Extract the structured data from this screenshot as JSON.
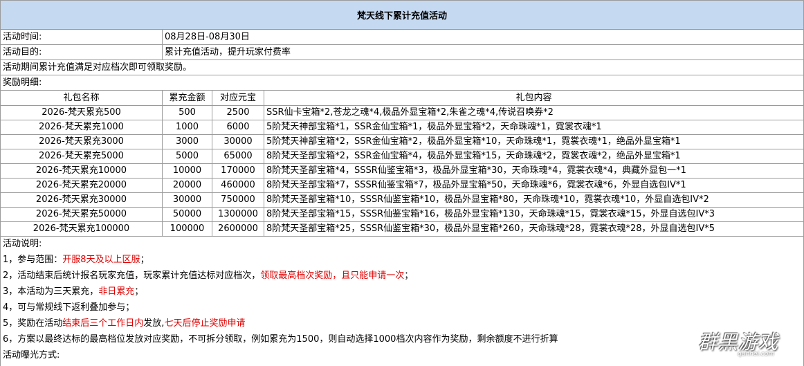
{
  "title": "梵天线下累计充值活动",
  "info": [
    {
      "label": "活动时间:",
      "value": "08月28日-08月30日"
    },
    {
      "label": "活动目的:",
      "value": "累计充值活动，提升玩家付费率"
    }
  ],
  "intro": "活动期间累计充值满足对应档次即可领取奖励。",
  "reward_label": "奖励明细:",
  "table": {
    "headers": [
      "礼包名称",
      "累充金额",
      "对应元宝",
      "礼包内容"
    ],
    "rows": [
      [
        "2026-梵天累充500",
        "500",
        "2500",
        "SSR仙卡宝箱*2,苍龙之魂*4,极品外显宝箱*2,朱雀之魂*4,传说召唤券*2"
      ],
      [
        "2026-梵天累充1000",
        "1000",
        "6000",
        "5阶梵天神部宝箱*1，SSR金仙宝箱*1，极品外显宝箱*2，天命珠魂*1，霓裳衣魂*1"
      ],
      [
        "2026-梵天累充3000",
        "3000",
        "30000",
        "5阶梵天神部宝箱*2，SSR金仙宝箱*2，极品外显宝箱*10，天命珠魂*1，霓裳衣魂*1，绝品外显宝箱*1"
      ],
      [
        "2026-梵天累充5000",
        "5000",
        "65000",
        "8阶梵天圣部宝箱*2，SSR金仙宝箱*4，极品外显宝箱*15，天命珠魂*2，霓裳衣魂*2，绝品外显宝箱*1"
      ],
      [
        "2026-梵天累充10000",
        "10000",
        "170000",
        "8阶梵天圣部宝箱*4，SSSR仙鉴宝箱*3，极品外显宝箱*30，天命珠魂*4，霓裳衣魂*4，典藏外显包一*1"
      ],
      [
        "2026-梵天累充20000",
        "20000",
        "460000",
        "8阶梵天圣部宝箱*7，SSSR仙鉴宝箱*7，极品外显宝箱*50，天命珠魂*6，霓裳衣魂*6，外显自选包IV*1"
      ],
      [
        "2026-梵天累充30000",
        "30000",
        "750000",
        "8阶梵天圣部宝箱*10，SSSR仙鉴宝箱*10，极品外显宝箱*80，天命珠魂*10，霓裳衣魂*10，外显自选包IV*2"
      ],
      [
        "2026-梵天累充50000",
        "50000",
        "1300000",
        "8阶梵天圣部宝箱*15，SSSR仙鉴宝箱*16，极品外显宝箱*130，天命珠魂*15，霓裳衣魂*15，外显自选包IV*3"
      ],
      [
        "2026-梵天累充100000",
        "100000",
        "2600000",
        "8阶梵天圣部宝箱*25，SSSR仙鉴宝箱*30，极品外显宝箱*260，天命珠魂*28，霓裳衣魂*28，外显自选包IV*5"
      ]
    ]
  },
  "notes_label": "活动说明:",
  "notes": [
    {
      "a": "1，参与范围：",
      "b": "开服8天及以上区服",
      "c": "；",
      "d": "",
      "e": ""
    },
    {
      "a": "2，活动结束后统计报名玩家充值，玩家累计充值达标对应档次，",
      "b": "领取最高档次奖励，且只能申请一次",
      "c": "；",
      "d": "",
      "e": ""
    },
    {
      "a": "3，本活动为三天累充，",
      "b": "非日累充",
      "c": "；",
      "d": "",
      "e": ""
    },
    {
      "a": "4，可与常规线下返利叠加参与；",
      "b": "",
      "c": "",
      "d": "",
      "e": ""
    },
    {
      "a": "5，奖励在活动",
      "b": "结束后三个工作日内",
      "c": "发放,",
      "d": "七天后停止奖励申请",
      "e": ""
    },
    {
      "a": "6，方案以最终达标的最高档位发放对应奖励，不可拆分领取，例如累充为1500，则自动选择1000档次内容作为奖励，剩余额度不进行折算",
      "b": "",
      "c": "",
      "d": "",
      "e": ""
    }
  ],
  "exposure_label": "活动曝光方式:",
  "watermark": {
    "main": "群黑游戏",
    "sub": "qunhei.com"
  },
  "colors": {
    "header_bg": "#c5d9f1",
    "highlight": "#e00000"
  }
}
